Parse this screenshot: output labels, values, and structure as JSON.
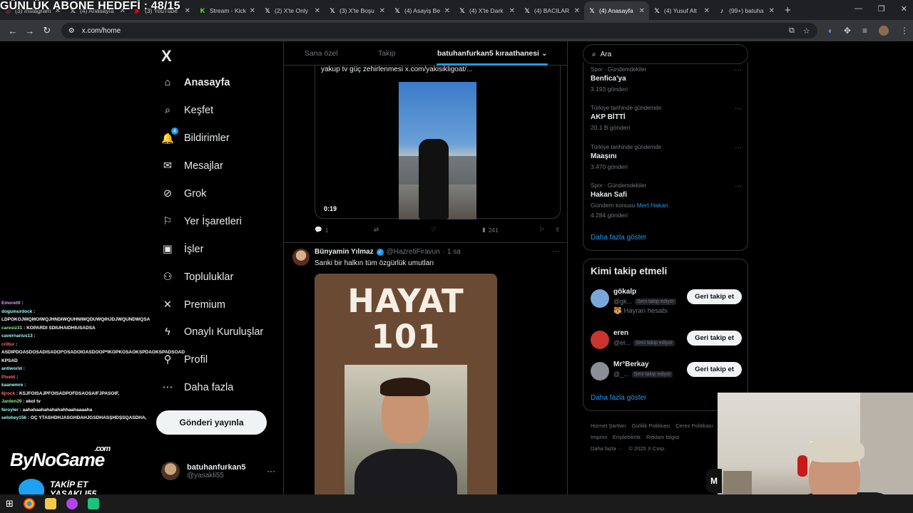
{
  "overlay": {
    "stream_title": "GÜNLÜK ABONE HEDEFİ : 48/15",
    "chat": [
      {
        "user": "Emorettt",
        "msg": "",
        "cls": "p"
      },
      {
        "user": "dogumurdock",
        "msg": "LDPOKOJWQMOIWQJHNDIWQUHNIWQDUWQIHJDJWQUNDWQSA",
        "cls": ""
      },
      {
        "user": "caresiz31",
        "msg": "KOPARDI SDIUHAIDHIUSADSA",
        "cls": "g"
      },
      {
        "user": "cavernarius13",
        "msg": "",
        "cls": ""
      },
      {
        "user": "criltur",
        "msg": "ASDIPDOASDOSADISADOI*OSADOIOASDOOP*IKOPKOSAOKSPDAOKSPADSOAD KPSAD",
        "cls": "r"
      },
      {
        "user": "antiworld",
        "msg": "",
        "cls": ""
      },
      {
        "user": "Pixeld",
        "msg": "",
        "cls": "r"
      },
      {
        "user": "kaanemre",
        "msg": "",
        "cls": ""
      },
      {
        "user": "6jrock",
        "msg": "KSJFOISAJPFOISADPOFDSAOSAIFJPASOIF,",
        "cls": "r"
      },
      {
        "user": "Jarden29",
        "msg": "ekol tv",
        "cls": "g"
      },
      {
        "user": "feroyler",
        "msg": "aahahaahahahahahhaahaaaaha",
        "cls": ""
      },
      {
        "user": "selobey156",
        "msg": "OÇ YTASHDHJASGHDAHJGSDHASŞHDŞSQASDHA,",
        "cls": ""
      }
    ],
    "brand": "ByNoGame",
    "brand_suffix": ".com",
    "takip_line1": "TAKİP ET",
    "takip_line2": "YASAKLI55"
  },
  "browser": {
    "tabs": [
      {
        "title": "(3) Instagram",
        "icon": "instagram-icon",
        "color": "#e1306c"
      },
      {
        "title": "(4) Anasayfa",
        "icon": "x-icon",
        "color": "#fff"
      },
      {
        "title": "(3) YouTube",
        "icon": "youtube-icon",
        "color": "#f00"
      },
      {
        "title": "Stream - Kick",
        "icon": "kick-icon",
        "color": "#53fc18"
      },
      {
        "title": "(2) X'te Only",
        "icon": "x-icon",
        "color": "#fff"
      },
      {
        "title": "(3) X'te Boşu",
        "icon": "x-icon",
        "color": "#fff"
      },
      {
        "title": "(4) Asayiş Be",
        "icon": "x-icon",
        "color": "#fff"
      },
      {
        "title": "(4) X'te Dark",
        "icon": "x-icon",
        "color": "#fff"
      },
      {
        "title": "(4) BACILAR",
        "icon": "x-icon",
        "color": "#fff"
      },
      {
        "title": "(4) Anasayfa",
        "icon": "x-icon",
        "color": "#fff",
        "active": true
      },
      {
        "title": "(4) Yusuf Alt",
        "icon": "x-icon",
        "color": "#fff"
      },
      {
        "title": "(99+) batuha",
        "icon": "tiktok-icon",
        "color": "#fff"
      }
    ],
    "url": "x.com/home"
  },
  "nav": {
    "logo": "X",
    "items": [
      {
        "label": "Anasayfa",
        "icon": "home-icon",
        "glyph": "⌂",
        "active": true
      },
      {
        "label": "Keşfet",
        "icon": "search-icon",
        "glyph": "⌕"
      },
      {
        "label": "Bildirimler",
        "icon": "bell-icon",
        "glyph": "🔔",
        "badge": "4"
      },
      {
        "label": "Mesajlar",
        "icon": "mail-icon",
        "glyph": "✉"
      },
      {
        "label": "Grok",
        "icon": "grok-icon",
        "glyph": "⊘"
      },
      {
        "label": "Yer İşaretleri",
        "icon": "bookmark-icon",
        "glyph": "⚐"
      },
      {
        "label": "İşler",
        "icon": "briefcase-icon",
        "glyph": "▣"
      },
      {
        "label": "Topluluklar",
        "icon": "communities-icon",
        "glyph": "⚇"
      },
      {
        "label": "Premium",
        "icon": "x-premium-icon",
        "glyph": "✕"
      },
      {
        "label": "Onaylı Kuruluşlar",
        "icon": "lightning-icon",
        "glyph": "ϟ"
      },
      {
        "label": "Profil",
        "icon": "profile-icon",
        "glyph": "⚲"
      },
      {
        "label": "Daha fazla",
        "icon": "more-circle-icon",
        "glyph": "⋯"
      }
    ],
    "post_button": "Gönderi yayınla",
    "account": {
      "name": "batuhanfurkan5",
      "handle": "@yasakli55"
    }
  },
  "feed": {
    "tabs": [
      "Sana özel",
      "Takip",
      "batuhanfurkan5 kıraathanesi"
    ],
    "post1": {
      "quote_text": "yakup tv güç zehirlenmesi  x.com/yakisikligoat/...",
      "video_time": "0:19",
      "replies": "1",
      "views": "241"
    },
    "post2": {
      "name": "Bünyamin Yılmaz",
      "handle": "@HazretiFiravun",
      "time": "· 1 sa",
      "text": "Sanki bir halkın tüm özgürlük umutları",
      "book_line1": "HAYAT",
      "book_line2": "101"
    }
  },
  "sidebar": {
    "search_placeholder": "Ara",
    "trends": [
      {
        "category": "Spor · Gündemdekiler",
        "name": "Benfica'ya",
        "meta": "3.193 gönderi"
      },
      {
        "category": "Türkiye tarihinde gündemde",
        "name": "AKP BİTTİ",
        "meta": "20,1 B gönderi"
      },
      {
        "category": "Türkiye tarihinde gündemde",
        "name": "Maaşını",
        "meta": "3.470 gönderi"
      },
      {
        "category": "Spor · Gündemdekiler",
        "name": "Hakan Safi",
        "meta_prefix": "Gündem konusu",
        "meta_link": "Mert Hakan",
        "meta": "4.284 gönderi"
      }
    ],
    "show_more": "Daha fazla göster",
    "who_title": "Kimi takip etmeli",
    "who": [
      {
        "name": "gökalp",
        "handle": "@gk...",
        "badge": "Seni takip ediyor",
        "extra": "🐯 Hayran hesabı",
        "button": "Geri takip et",
        "avatar": "#7aa7d9"
      },
      {
        "name": "eren",
        "handle": "@er...",
        "badge": "Seni takip ediyor",
        "button": "Geri takip et",
        "avatar": "#c9342e"
      },
      {
        "name": "Mr°Berkay",
        "handle": "@_...",
        "badge": "Seni takip ediyor",
        "button": "Geri takip et",
        "avatar": "#8a8f96"
      }
    ],
    "who_more": "Daha fazla göster",
    "footer": [
      "Hizmet Şartları",
      "Gizlilik Politikası",
      "Çerez Politikası",
      "Imprint",
      "Erişilebilirlik",
      "Reklam bilgisi",
      "Daha fazla ···",
      "© 2025 X Corp."
    ]
  },
  "webcam": {
    "side_label": "M"
  }
}
